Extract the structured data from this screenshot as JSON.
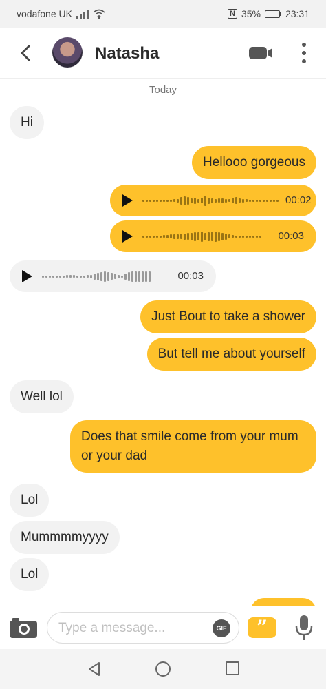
{
  "status_bar": {
    "carrier": "vodafone UK",
    "nfc": "N",
    "battery": "35%",
    "battery_level": 0.35,
    "time": "23:31",
    "icons": [
      "signal-icon",
      "wifi-icon",
      "nfc-icon",
      "battery-icon"
    ]
  },
  "header": {
    "contact_name": "Natasha",
    "icons": [
      "back-arrow-icon",
      "avatar",
      "video-call-icon",
      "more-vertical-icon"
    ]
  },
  "chat": {
    "date_label": "Today",
    "messages": [
      {
        "dir": "in",
        "type": "text",
        "text": "Hi"
      },
      {
        "dir": "out",
        "type": "text",
        "text": "Hellooo gorgeous"
      },
      {
        "dir": "out",
        "type": "voice",
        "duration": "00:02"
      },
      {
        "dir": "out",
        "type": "voice",
        "duration": "00:03"
      },
      {
        "dir": "in",
        "type": "voice",
        "duration": "00:03"
      },
      {
        "dir": "out",
        "type": "text",
        "text": "Just Bout to take a shower"
      },
      {
        "dir": "out",
        "type": "text",
        "text": "But tell me about yourself"
      },
      {
        "dir": "in",
        "type": "text",
        "text": "Well lol"
      },
      {
        "dir": "out",
        "type": "text",
        "text": "Does that smile come from your mum or your dad"
      },
      {
        "dir": "in",
        "type": "text",
        "text": "Lol"
      },
      {
        "dir": "in",
        "type": "text",
        "text": "Mummmmyyyy"
      },
      {
        "dir": "in",
        "type": "text",
        "text": "Lol"
      }
    ]
  },
  "composer": {
    "placeholder": "Type a message...",
    "gif_label": "GIF",
    "quote_label": "”",
    "icons": [
      "camera-icon",
      "gif-icon",
      "quote-icon",
      "microphone-icon"
    ]
  },
  "nav_bar": {
    "icons": [
      "nav-back-icon",
      "nav-home-icon",
      "nav-recents-icon"
    ]
  },
  "colors": {
    "accent": "#fec12b",
    "incoming_bubble": "#f2f2f2",
    "status_bar_bg": "#f2f2f2"
  }
}
